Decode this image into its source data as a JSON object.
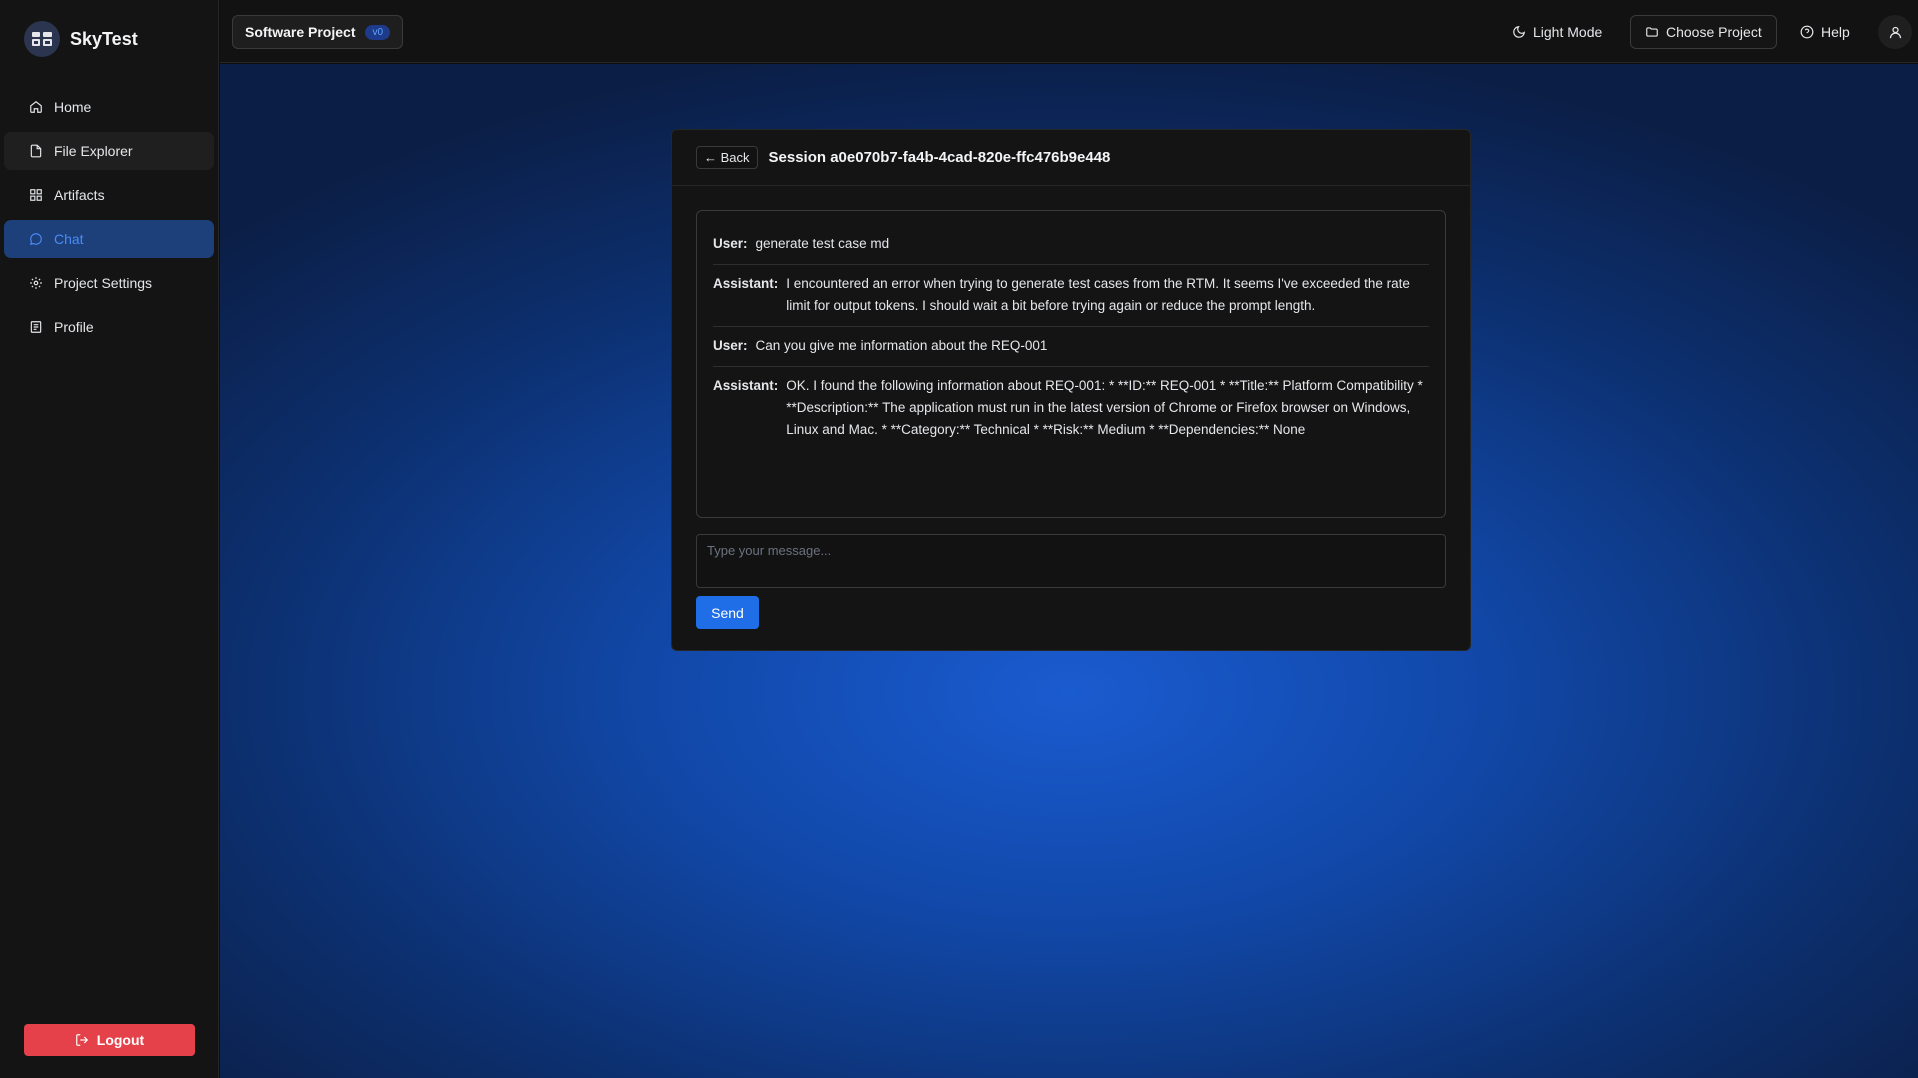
{
  "app": {
    "name": "SkyTest"
  },
  "sidebar": {
    "items": [
      {
        "label": "Home",
        "icon": "home-icon"
      },
      {
        "label": "File Explorer",
        "icon": "file-icon"
      },
      {
        "label": "Artifacts",
        "icon": "grid-icon"
      },
      {
        "label": "Chat",
        "icon": "chat-bubble-icon",
        "active": true
      },
      {
        "label": "Project Settings",
        "icon": "gear-icon"
      },
      {
        "label": "Profile",
        "icon": "profile-icon"
      }
    ],
    "logout_label": "Logout"
  },
  "header": {
    "project_name": "Software Project",
    "project_version": "v0",
    "light_mode_label": "Light Mode",
    "choose_project_label": "Choose Project",
    "help_label": "Help"
  },
  "session": {
    "back_label": "← Back",
    "title": "Session a0e070b7-fa4b-4cad-820e-ffc476b9e448",
    "messages": [
      {
        "role": "User:",
        "text": "generate test case md"
      },
      {
        "role": "Assistant:",
        "text": "I encountered an error when trying to generate test cases from the RTM. It seems I've exceeded the rate limit for output tokens. I should wait a bit before trying again or reduce the prompt length."
      },
      {
        "role": "User:",
        "text": "Can you give me information about the REQ-001"
      },
      {
        "role": "Assistant:",
        "text": "OK. I found the following information about REQ-001: * **ID:** REQ-001 * **Title:** Platform Compatibility * **Description:** The application must run in the latest version of Chrome or Firefox browser on Windows, Linux and Mac. * **Category:** Technical * **Risk:** Medium * **Dependencies:** None"
      }
    ],
    "input_placeholder": "Type your message...",
    "send_label": "Send"
  },
  "colors": {
    "accent": "#1f6ee8",
    "active_nav_bg": "#1d3f7a",
    "active_nav_text": "#4b8bf5",
    "logout": "#e5414a"
  }
}
